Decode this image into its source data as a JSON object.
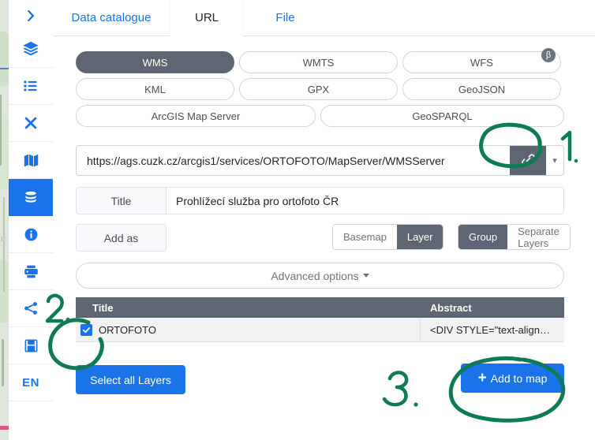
{
  "app": {
    "accent_blue": "#1a73e8",
    "selected_gray": "#5f6673",
    "annotation_green": "#0f7b54"
  },
  "sidebar": {
    "items": [
      {
        "name": "expand-panel",
        "icon": "chevron-right-icon",
        "label": "",
        "active": false
      },
      {
        "name": "layers",
        "icon": "layers-icon",
        "label": "",
        "active": false
      },
      {
        "name": "legend",
        "icon": "list-icon",
        "label": "",
        "active": false
      },
      {
        "name": "tools",
        "icon": "tools-cross-icon",
        "label": "",
        "active": false
      },
      {
        "name": "basemaps",
        "icon": "map-icon",
        "label": "",
        "active": false
      },
      {
        "name": "data",
        "icon": "database-icon",
        "label": "",
        "active": true
      },
      {
        "name": "info",
        "icon": "info-icon",
        "label": "",
        "active": false
      },
      {
        "name": "print",
        "icon": "printer-icon",
        "label": "",
        "active": false
      },
      {
        "name": "share",
        "icon": "share-icon",
        "label": "",
        "active": false
      },
      {
        "name": "save",
        "icon": "floppy-save-icon",
        "label": "",
        "active": false
      },
      {
        "name": "language",
        "icon": "",
        "label": "EN",
        "active": false
      }
    ]
  },
  "tabs": [
    {
      "label": "Data catalogue",
      "active": false
    },
    {
      "label": "URL",
      "active": true
    },
    {
      "label": "File",
      "active": false
    }
  ],
  "service_types": {
    "row1": [
      {
        "label": "WMS",
        "selected": true
      },
      {
        "label": "WMTS",
        "selected": false
      },
      {
        "label": "WFS",
        "selected": false
      }
    ],
    "row2": [
      {
        "label": "KML",
        "selected": false
      },
      {
        "label": "GPX",
        "selected": false
      },
      {
        "label": "GeoJSON",
        "selected": false
      }
    ],
    "row3": [
      {
        "label": "ArcGIS Map Server",
        "selected": false
      },
      {
        "label": "GeoSPARQL",
        "selected": false
      }
    ],
    "beta_badge": "β"
  },
  "url_field": {
    "value": "https://ags.cuzk.cz/arcgis1/services/ORTOFOTO/MapServer/WMSServer",
    "placeholder": "Enter service URL",
    "link_button_icon": "link-icon",
    "caret_icon": "chevron-down-icon"
  },
  "title_field": {
    "label": "Title",
    "value": "Prohlížecí služba pro ortofoto ČR",
    "placeholder": ""
  },
  "add_as": {
    "label": "Add as",
    "group1": [
      {
        "label": "Basemap",
        "selected": false
      },
      {
        "label": "Layer",
        "selected": true
      }
    ],
    "group2": [
      {
        "label": "Group",
        "selected": true
      },
      {
        "label": "Separate Layers",
        "selected": false
      }
    ]
  },
  "advanced_options": {
    "label": "Advanced options"
  },
  "layers_table": {
    "columns": [
      "Title",
      "Abstract"
    ],
    "rows": [
      {
        "checked": true,
        "title": "ORTOFOTO",
        "abstract": "<DIV STYLE=\"text-align…"
      }
    ]
  },
  "buttons": {
    "select_all": "Select all Layers",
    "add_to_map": "Add to map",
    "add_to_map_icon": "plus-icon"
  },
  "annotations": [
    {
      "name": "step-1",
      "label": "1.",
      "target": "url-link-button"
    },
    {
      "name": "step-2",
      "label": "2.",
      "target": "layer-row-checkbox"
    },
    {
      "name": "step-3",
      "label": "3.",
      "target": "add-to-map-button"
    }
  ]
}
